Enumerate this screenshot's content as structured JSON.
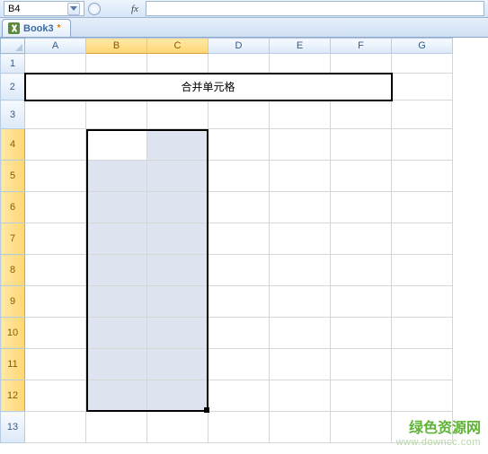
{
  "formula_bar": {
    "cell_reference": "B4",
    "fx_label": "fx",
    "formula_value": ""
  },
  "workbook": {
    "tab_name": "Book3",
    "modified_indicator": "*"
  },
  "columns": [
    "A",
    "B",
    "C",
    "D",
    "E",
    "F",
    "G"
  ],
  "rows": [
    "1",
    "2",
    "3",
    "4",
    "5",
    "6",
    "7",
    "8",
    "9",
    "10",
    "11",
    "12",
    "13"
  ],
  "selected_columns": [
    "B",
    "C"
  ],
  "selected_rows": [
    "4",
    "5",
    "6",
    "7",
    "8",
    "9",
    "10",
    "11",
    "12"
  ],
  "active_cell": "B4",
  "merged_cell": {
    "range": "A2:F2",
    "text": "合并单元格"
  },
  "watermark": {
    "line1": "绿色资源网",
    "line2": "www.downcc.com"
  }
}
